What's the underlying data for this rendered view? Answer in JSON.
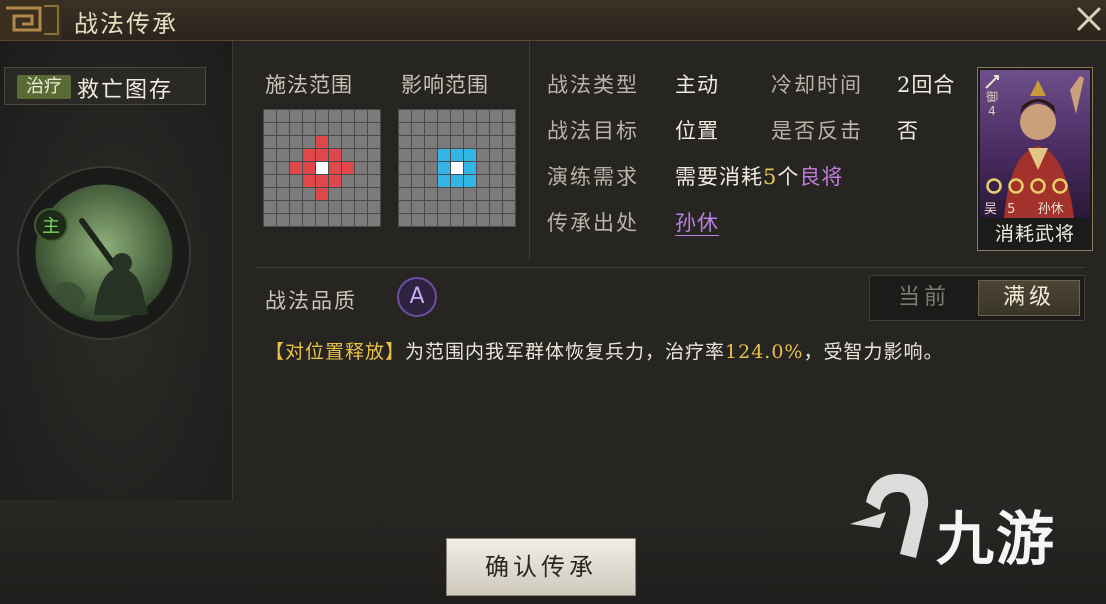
{
  "window": {
    "title": "战法传承",
    "close_icon": "close-icon"
  },
  "left_panel": {
    "skill_type_badge": "治疗",
    "skill_name": "救亡图存",
    "main_badge": "主",
    "portrait_icon": "warrior-sword-icon"
  },
  "ranges": {
    "cast_label": "施法范围",
    "effect_label": "影响范围",
    "cast_pattern": [
      "000000000",
      "000000000",
      "000010000",
      "000111000",
      "001121100",
      "000111000",
      "000010000",
      "000000000",
      "000000000"
    ],
    "effect_pattern": [
      "000000000",
      "000000000",
      "000000000",
      "000333000",
      "000323000",
      "000333000",
      "000000000",
      "000000000",
      "000000000"
    ]
  },
  "info": {
    "type_label": "战法类型",
    "type_value": "主动",
    "cooldown_label": "冷却时间",
    "cooldown_value": "2回合",
    "target_label": "战法目标",
    "target_value": "位置",
    "counter_label": "是否反击",
    "counter_value": "否",
    "train_label": "演练需求",
    "train_prefix": "需要消耗",
    "train_count": "5",
    "train_unit": "个",
    "train_quality": "良将",
    "source_label": "传承出处",
    "source_value": "孙休"
  },
  "general_card": {
    "troop": "御",
    "troop_level": "4",
    "stars": "cccc",
    "faction": "吴",
    "cost": "5",
    "name": "孙休",
    "footer": "消耗武将"
  },
  "quality": {
    "label": "战法品质",
    "grade": "A"
  },
  "toggle": {
    "current": "当前",
    "max": "满级"
  },
  "description": {
    "tag": "【对位置释放】",
    "part1": "为范围内我军群体恢复兵力，治疗率",
    "rate": "124.0%",
    "part2": "，受智力影响。"
  },
  "footer": {
    "confirm": "确认传承"
  },
  "watermark": {
    "logo_icon": "9game-logo-icon",
    "text": "九游"
  },
  "colors": {
    "cast_cell": "#e0474a",
    "effect_cell": "#33b5e6",
    "gold": "#e8c04a",
    "purple": "#c17be0",
    "badge_green": "#5a6b36"
  }
}
